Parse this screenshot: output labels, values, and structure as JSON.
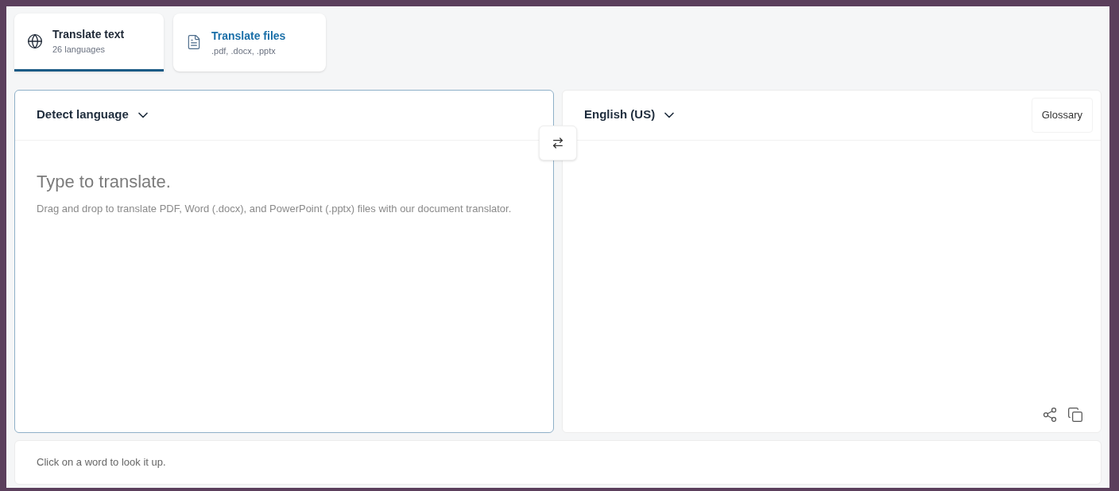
{
  "tabs": [
    {
      "kind": "globe",
      "title": "Translate text",
      "subtitle": "26 languages",
      "selected": true
    },
    {
      "kind": "document",
      "title": "Translate files",
      "subtitle": ".pdf, .docx, .pptx",
      "selected": false
    }
  ],
  "source": {
    "language": "Detect language",
    "placeholder": "Type to translate.",
    "hint": "Drag and drop to translate PDF, Word (.docx), and PowerPoint (.pptx) files with our document translator."
  },
  "target": {
    "language": "English (US)",
    "glossary": "Glossary"
  },
  "dictionary": {
    "text": "Click on a word to look it up."
  }
}
